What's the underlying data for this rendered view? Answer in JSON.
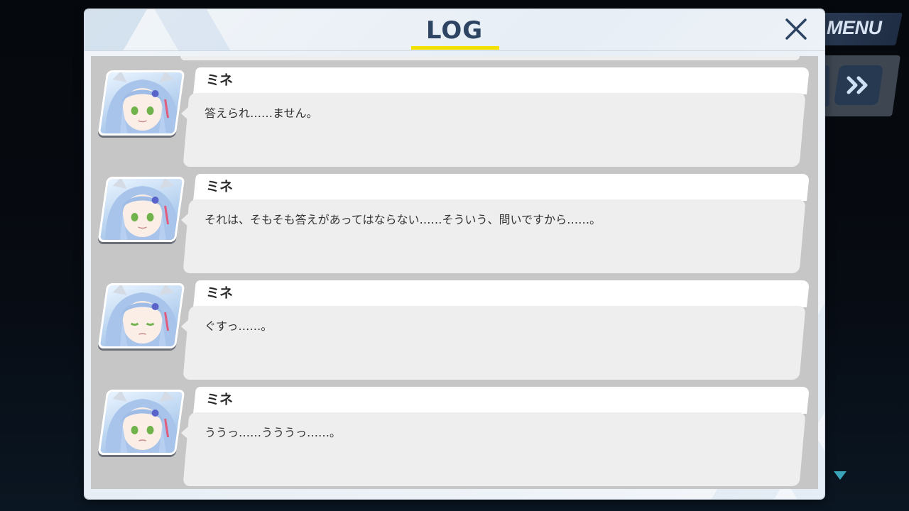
{
  "hud": {
    "menu_label": "MENU",
    "skip_icon": "double-chevron-right-icon",
    "scroll_icon": "triangle-down-icon"
  },
  "dialog": {
    "title": "LOG",
    "close_icon": "close-icon",
    "accent_color": "#f2e100",
    "title_color": "#2e4463"
  },
  "log": {
    "entries": [
      {
        "speaker": "ミネ",
        "text": "答えられ……ません。"
      },
      {
        "speaker": "ミネ",
        "text": "それは、そもそも答えがあってはならない……そういう、問いですから……。"
      },
      {
        "speaker": "ミネ",
        "text": "ぐすっ……。"
      },
      {
        "speaker": "ミネ",
        "text": "ううっ……うううっ……。"
      }
    ]
  }
}
